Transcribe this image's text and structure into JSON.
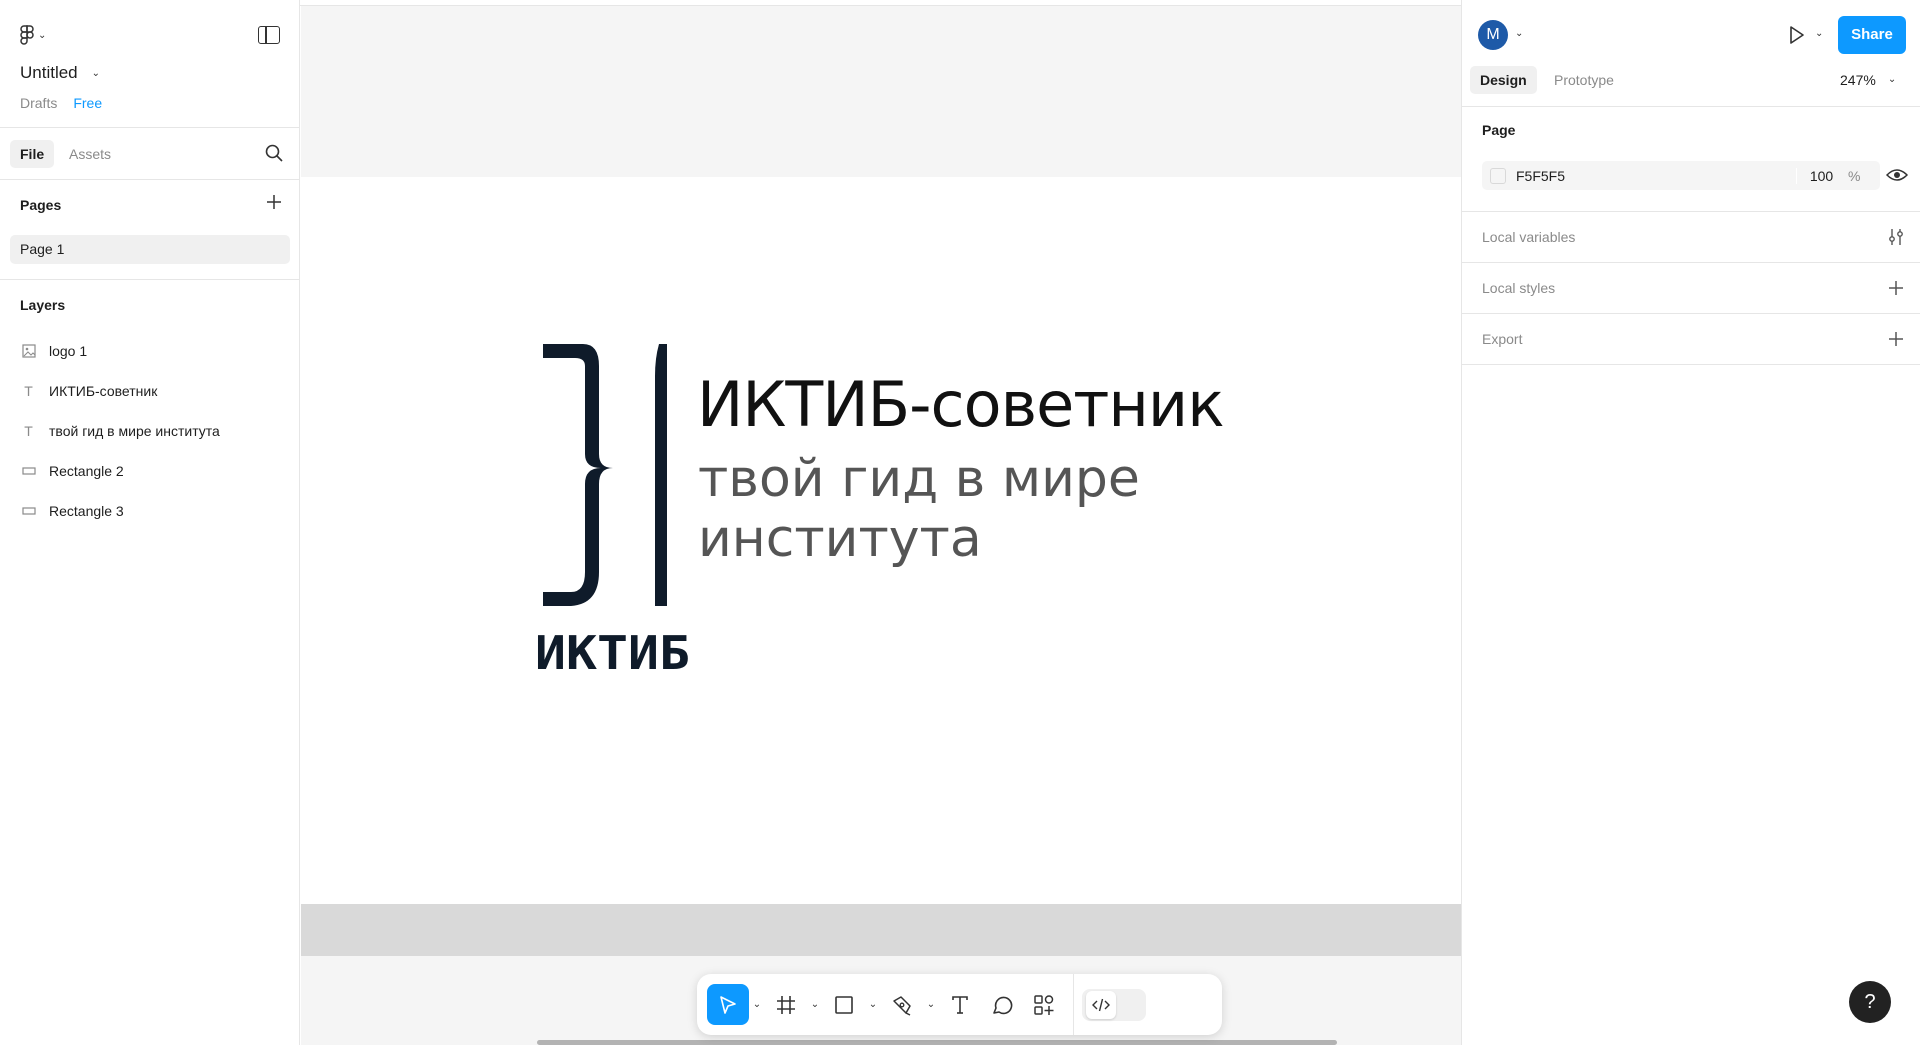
{
  "file": {
    "title": "Untitled",
    "location": "Drafts",
    "plan": "Free"
  },
  "left_tabs": {
    "file": "File",
    "assets": "Assets"
  },
  "pages": {
    "header": "Pages",
    "items": [
      "Page 1"
    ]
  },
  "layers": {
    "header": "Layers",
    "items": [
      {
        "name": "logo 1",
        "icon": "image-icon"
      },
      {
        "name": "ИКТИБ-советник",
        "icon": "text-icon"
      },
      {
        "name": "твой гид в мире института",
        "icon": "text-icon"
      },
      {
        "name": "Rectangle 2",
        "icon": "rectangle-icon"
      },
      {
        "name": "Rectangle 3",
        "icon": "rectangle-icon"
      }
    ]
  },
  "canvas": {
    "logo_text": "ИКТИБ",
    "title": "ИКТИБ-советник",
    "subtitle_line1": "твой гид в мире",
    "subtitle_line2": "института"
  },
  "toolbar": {
    "tools": [
      "move-tool",
      "frame-tool",
      "shape-tool",
      "pen-tool",
      "text-tool",
      "comment-tool",
      "actions-tool",
      "dev-mode-toggle"
    ]
  },
  "right_panel": {
    "avatar_letter": "M",
    "share_label": "Share",
    "tab_design": "Design",
    "tab_prototype": "Prototype",
    "zoom": "247%",
    "page_section": "Page",
    "page_fill_hex": "F5F5F5",
    "page_fill_opacity": "100",
    "page_fill_unit": "%",
    "local_variables": "Local variables",
    "local_styles": "Local styles",
    "export": "Export"
  },
  "help_label": "?",
  "colors": {
    "accent": "#0d99ff",
    "canvas_bg": "#f5f5f5",
    "logo_dark": "#0f1b2a"
  }
}
